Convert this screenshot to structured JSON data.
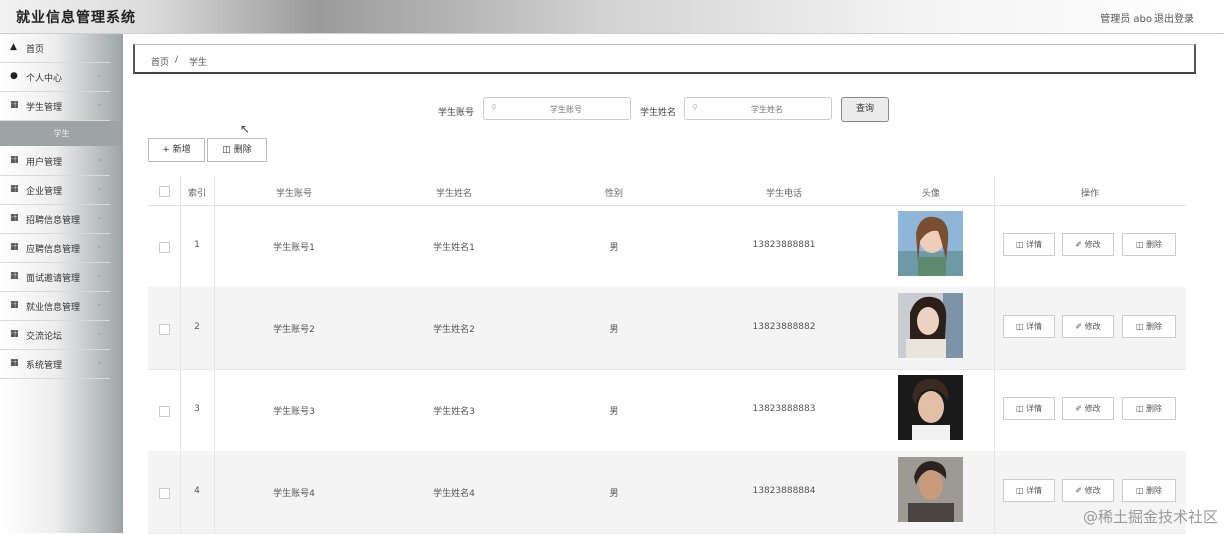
{
  "app": {
    "title": "就业信息管理系统",
    "user_label": "管理员 abo",
    "logout_label": "退出登录"
  },
  "sidebar": {
    "items": [
      {
        "label": "首页",
        "icon": "home-icon"
      },
      {
        "label": "个人中心",
        "icon": "person-icon"
      },
      {
        "label": "学生管理",
        "icon": "grid-icon"
      },
      {
        "label": "用户管理",
        "icon": "grid-icon"
      },
      {
        "label": "企业管理",
        "icon": "grid-icon"
      },
      {
        "label": "招聘信息管理",
        "icon": "grid-icon"
      },
      {
        "label": "应聘信息管理",
        "icon": "grid-icon"
      },
      {
        "label": "面试邀请管理",
        "icon": "grid-icon"
      },
      {
        "label": "就业信息管理",
        "icon": "grid-icon"
      },
      {
        "label": "交流论坛",
        "icon": "grid-icon"
      },
      {
        "label": "系统管理",
        "icon": "grid-icon"
      }
    ],
    "active_sub": "学生"
  },
  "breadcrumb": {
    "home": "首页",
    "sep": "/",
    "current": "学生"
  },
  "search": {
    "account_label": "学生账号",
    "account_placeholder": "学生账号",
    "name_label": "学生姓名",
    "name_placeholder": "学生姓名",
    "query_button": "查询"
  },
  "actions": {
    "add": "+ 新增",
    "delete": "删除"
  },
  "table": {
    "headers": [
      "索引",
      "学生账号",
      "学生姓名",
      "性别",
      "学生电话",
      "头像",
      "操作"
    ],
    "rows": [
      {
        "index": "1",
        "account": "学生账号1",
        "name": "学生姓名1",
        "gender": "男",
        "phone": "13823888881"
      },
      {
        "index": "2",
        "account": "学生账号2",
        "name": "学生姓名2",
        "gender": "男",
        "phone": "13823888882"
      },
      {
        "index": "3",
        "account": "学生账号3",
        "name": "学生姓名3",
        "gender": "男",
        "phone": "13823888883"
      },
      {
        "index": "4",
        "account": "学生账号4",
        "name": "学生姓名4",
        "gender": "男",
        "phone": "13823888884"
      }
    ],
    "op_detail": "详情",
    "op_edit": "修改",
    "op_delete": "删除"
  },
  "watermark": "@稀土掘金技术社区"
}
